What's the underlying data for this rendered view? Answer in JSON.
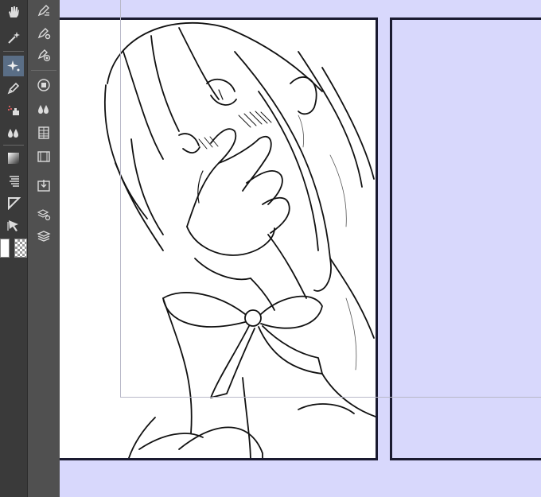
{
  "app": {
    "toolbar": {
      "tools": [
        {
          "name": "hand-tool",
          "icon": "hand-icon",
          "active": false
        },
        {
          "name": "auto-select-tool",
          "icon": "magic-wand-icon",
          "active": false
        },
        {
          "name": "sparkle-tool",
          "icon": "sparkle-icon",
          "active": true
        },
        {
          "name": "pen-tool",
          "icon": "pen-icon",
          "active": false
        },
        {
          "name": "airbrush-tool",
          "icon": "airbrush-icon",
          "active": false
        },
        {
          "name": "fill-tool",
          "icon": "droplets-icon",
          "active": false
        },
        {
          "name": "gradient-tool",
          "icon": "gradient-icon",
          "active": false
        },
        {
          "name": "hatching-tool",
          "icon": "hatching-icon",
          "active": false
        },
        {
          "name": "ruler-tool",
          "icon": "ruler-icon",
          "active": false
        },
        {
          "name": "operation-tool",
          "icon": "arrow-select-icon",
          "active": false
        }
      ],
      "sub_tools": [
        {
          "name": "sub-tool-settings",
          "icon": "brush-settings-icon"
        },
        {
          "name": "sub-tool-gear",
          "icon": "gear-brush-icon"
        },
        {
          "name": "sub-tool-target",
          "icon": "target-brush-icon"
        },
        {
          "name": "sub-tool-layer-circle",
          "icon": "layer-circle-icon"
        },
        {
          "name": "sub-tool-droplets",
          "icon": "droplets-icon"
        },
        {
          "name": "sub-tool-filmstrip",
          "icon": "filmstrip-icon"
        },
        {
          "name": "sub-tool-filmstrip-2",
          "icon": "filmstrip-icon"
        },
        {
          "name": "sub-tool-import",
          "icon": "import-icon"
        },
        {
          "name": "sub-tool-layers-gear",
          "icon": "layers-gear-icon"
        },
        {
          "name": "sub-tool-layers",
          "icon": "layers-icon"
        }
      ],
      "main_color": "#ffffff",
      "sub_color": "transparent"
    },
    "canvas": {
      "background": "#d8d8fc",
      "panel_border_color": "#1a1a30",
      "guide_color": "#b8b8c8"
    }
  }
}
